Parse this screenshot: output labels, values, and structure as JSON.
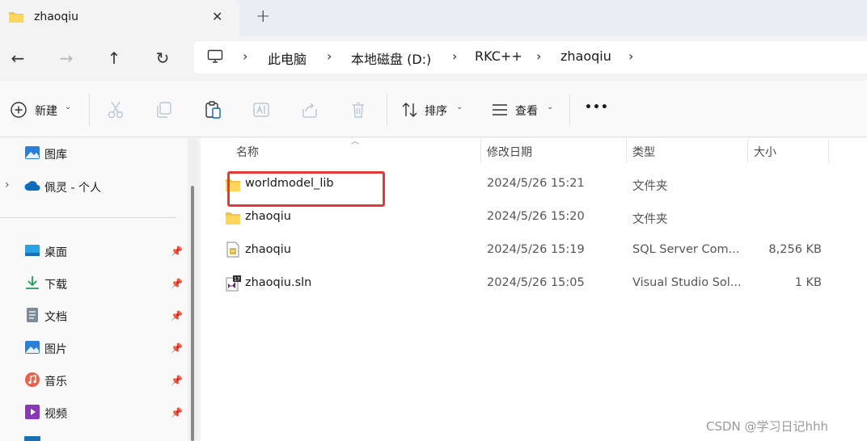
{
  "tab": {
    "title": "zhaoqiu",
    "close": "✕",
    "new_tab": "+"
  },
  "nav": {
    "back": "←",
    "forward": "→",
    "up": "↑",
    "refresh": "↻"
  },
  "address": {
    "crumbs": [
      "此电脑",
      "本地磁盘 (D:)",
      "RKC++",
      "zhaoqiu"
    ],
    "separator": "›"
  },
  "toolbar": {
    "new_label": "新建",
    "sort_label": "排序",
    "view_label": "查看",
    "more": "•••"
  },
  "sidebar": {
    "top_items": [
      {
        "label": "图库",
        "icon": "gallery-icon"
      },
      {
        "label": "佩灵 - 个人",
        "icon": "onedrive-cloud-icon"
      }
    ],
    "pinned": [
      {
        "label": "桌面",
        "icon": "desktop-icon"
      },
      {
        "label": "下载",
        "icon": "download-icon"
      },
      {
        "label": "文档",
        "icon": "document-icon"
      },
      {
        "label": "图片",
        "icon": "pictures-icon"
      },
      {
        "label": "音乐",
        "icon": "music-icon"
      },
      {
        "label": "视频",
        "icon": "video-icon"
      }
    ]
  },
  "columns": {
    "name": "名称",
    "modified": "修改日期",
    "type": "类型",
    "size": "大小"
  },
  "files": [
    {
      "name": "worldmodel_lib",
      "modified": "2024/5/26 15:21",
      "type": "文件夹",
      "size": "",
      "icon": "folder-icon"
    },
    {
      "name": "zhaoqiu",
      "modified": "2024/5/26 15:20",
      "type": "文件夹",
      "size": "",
      "icon": "folder-icon"
    },
    {
      "name": "zhaoqiu",
      "modified": "2024/5/26 15:19",
      "type": "SQL Server Com...",
      "size": "8,256 KB",
      "icon": "sql-file-icon"
    },
    {
      "name": "zhaoqiu.sln",
      "modified": "2024/5/26 15:05",
      "type": "Visual Studio Sol...",
      "size": "1 KB",
      "icon": "visual-studio-solution-icon"
    }
  ],
  "watermark": "CSDN @学习日记hhh",
  "colors": {
    "highlight": "#e53935",
    "folder": "#f5c242",
    "accent": "#0067c0"
  }
}
